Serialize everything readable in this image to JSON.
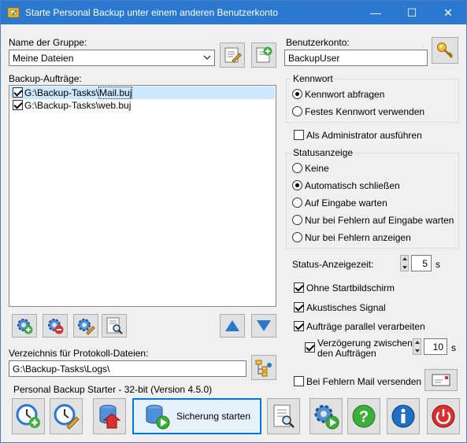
{
  "window": {
    "title": "Starte Personal Backup unter einem anderen Benutzerkonto",
    "controls": {
      "minimize": "—",
      "maximize": "☐",
      "close": "✕"
    }
  },
  "group": {
    "label": "Name der Gruppe:",
    "selected": "Meine Dateien"
  },
  "jobs": {
    "label": "Backup-Aufträge:",
    "items": [
      {
        "path_prefix": "G:\\Backup-Tasks\\",
        "file": "Mail.buj",
        "checked": true,
        "selected": true
      },
      {
        "path_prefix": "G:\\Backup-Tasks\\",
        "file": "web.buj",
        "checked": true,
        "selected": false
      }
    ]
  },
  "account": {
    "label": "Benutzerkonto:",
    "value": "BackupUser"
  },
  "password": {
    "legend": "Kennwort",
    "options": [
      "Kennwort abfragen",
      "Festes Kennwort verwenden"
    ],
    "selected_index": 0
  },
  "admin": {
    "label": "Als Administrator ausführen",
    "checked": false
  },
  "status": {
    "legend": "Statusanzeige",
    "options": [
      "Keine",
      "Automatisch schließen",
      "Auf Eingabe warten",
      "Nur bei Fehlern auf Eingabe warten",
      "Nur bei Fehlern anzeigen"
    ],
    "selected_index": 1
  },
  "status_time": {
    "label": "Status-Anzeigezeit:",
    "value": "5",
    "unit": "s"
  },
  "options": {
    "no_splash": {
      "label": "Ohne Startbildschirm",
      "checked": true
    },
    "sound": {
      "label": "Akustisches Signal",
      "checked": true
    },
    "parallel": {
      "label": "Aufträge parallel verarbeiten",
      "checked": true
    },
    "delay": {
      "label_line1": "Verzögerung zwischen",
      "label_line2": "den Aufträgen",
      "checked": true,
      "value": "10",
      "unit": "s"
    },
    "mail": {
      "label": "Bei Fehlern Mail versenden",
      "checked": false
    }
  },
  "log_dir": {
    "label": "Verzeichnis für Protokoll-Dateien:",
    "value": "G:\\Backup-Tasks\\Logs\\"
  },
  "version_text": "Personal Backup Starter - 32-bit (Version 4.5.0)",
  "start_button_label": "Sicherung starten",
  "colors": {
    "titlebar": "#2b78d0",
    "accent_blue": "#0078d7",
    "green": "#3cae3c",
    "red": "#d93030",
    "info_blue": "#1f6fc4"
  }
}
